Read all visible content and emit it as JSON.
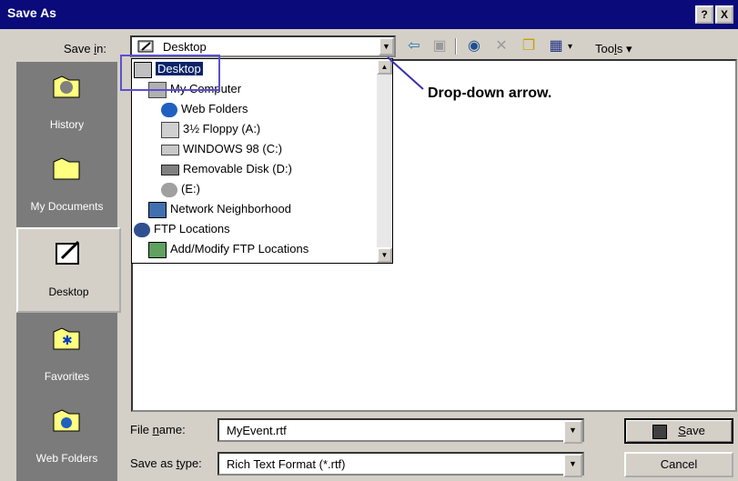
{
  "window": {
    "title": "Save As",
    "help_btn": "?",
    "close_btn": "X"
  },
  "toolbar": {
    "save_in_label_pre": "Save ",
    "save_in_label_u": "i",
    "save_in_label_post": "n:",
    "save_in_value": "Desktop",
    "tools_label_pre": "Too",
    "tools_label_u": "l",
    "tools_label_post": "s ▾"
  },
  "places": [
    {
      "label": "History"
    },
    {
      "label": "My Documents"
    },
    {
      "label": "Desktop"
    },
    {
      "label": "Favorites"
    },
    {
      "label": "Web Folders"
    }
  ],
  "dropdown": {
    "items": [
      {
        "label": "Desktop",
        "icon": "desktop-icon",
        "selected": true
      },
      {
        "label": "My Computer",
        "icon": "computer-icon"
      },
      {
        "label": "Web Folders",
        "icon": "web-folders-icon"
      },
      {
        "label": "3½ Floppy (A:)",
        "icon": "floppy-icon"
      },
      {
        "label": "WINDOWS 98 (C:)",
        "icon": "hard-drive-icon"
      },
      {
        "label": "Removable Disk (D:)",
        "icon": "removable-disk-icon"
      },
      {
        "label": "(E:)",
        "icon": "cd-drive-icon"
      },
      {
        "label": "Network Neighborhood",
        "icon": "network-icon"
      },
      {
        "label": "FTP Locations",
        "icon": "ftp-icon"
      },
      {
        "label": "Add/Modify FTP Locations",
        "icon": "ftp-add-icon"
      }
    ]
  },
  "annotation": {
    "callout": "Drop-down arrow."
  },
  "bottom": {
    "file_name_label_pre": "File ",
    "file_name_label_u": "n",
    "file_name_label_post": "ame:",
    "file_name_value": "MyEvent.rtf",
    "save_type_label_pre": "Save as ",
    "save_type_label_u": "t",
    "save_type_label_post": "ype:",
    "save_type_value": "Rich Text Format (*.rtf)",
    "save_btn_u": "S",
    "save_btn_post": "ave",
    "cancel_btn": "Cancel"
  },
  "colors": {
    "titlebar": "#0a0a7a",
    "places_bg": "#7b7b7b",
    "selection": "#0a246a",
    "callout": "#5b4fd0"
  }
}
